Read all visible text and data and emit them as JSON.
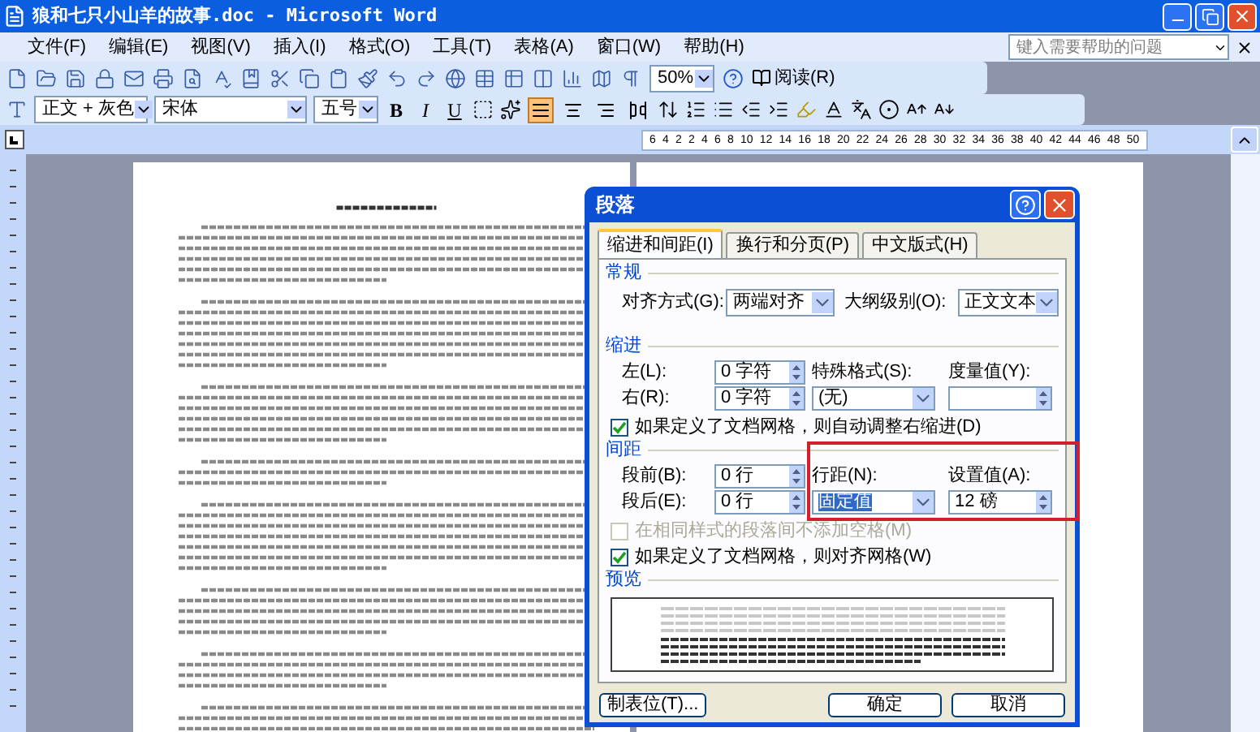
{
  "window": {
    "title": "狼和七只小山羊的故事.doc - Microsoft Word"
  },
  "menu": [
    "文件(F)",
    "编辑(E)",
    "视图(V)",
    "插入(I)",
    "格式(O)",
    "工具(T)",
    "表格(A)",
    "窗口(W)",
    "帮助(H)"
  ],
  "help_search": {
    "placeholder": "键入需要帮助的问题"
  },
  "standard_toolbar": {
    "zoom": "50%",
    "read_button": "阅读(R)"
  },
  "format_toolbar": {
    "style": "正文 + 灰色",
    "font": "宋体",
    "size": "五号",
    "text_buttons": [
      "B",
      "I",
      "U"
    ],
    "alignment": [
      {
        "kind": "justify",
        "selected": true
      },
      {
        "kind": "center",
        "selected": false
      },
      {
        "kind": "right",
        "selected": false
      },
      {
        "kind": "distributed",
        "selected": false
      }
    ]
  },
  "ruler": {
    "numbers": [
      "6",
      "4",
      "2",
      "2",
      "4",
      "6",
      "8",
      "10",
      "12",
      "14",
      "16",
      "18",
      "20",
      "22",
      "24",
      "26",
      "28",
      "30",
      "32",
      "34",
      "36",
      "38",
      "40",
      "42",
      "44",
      "46",
      "48",
      "50"
    ]
  },
  "dialog": {
    "title": "段落",
    "tabs": [
      {
        "label": "缩进和间距(I)",
        "selected": true
      },
      {
        "label": "换行和分页(P)",
        "selected": false
      },
      {
        "label": "中文版式(H)",
        "selected": false
      }
    ],
    "general": {
      "heading": "常规",
      "fields": [
        {
          "kind": "dropdown",
          "label": "对齐方式(G):",
          "value": "两端对齐"
        },
        {
          "kind": "dropdown",
          "label": "大纲级别(O):",
          "value": "正文文本"
        }
      ]
    },
    "indent": {
      "heading": "缩进",
      "left": [
        {
          "kind": "spinner",
          "label": "左(L):",
          "value": "0 字符"
        },
        {
          "kind": "spinner",
          "label": "右(R):",
          "value": "0 字符"
        }
      ],
      "right": [
        {
          "kind": "dropdown",
          "label": "特殊格式(S):",
          "value": "(无)"
        },
        {
          "kind": "spinner",
          "label": "度量值(Y):"
        }
      ]
    },
    "indent_checkbox": {
      "label": "如果定义了文档网格，则自动调整右缩进(D)",
      "checked": true,
      "disabled": false
    },
    "spacing": {
      "heading": "间距",
      "left": [
        {
          "kind": "spinner",
          "label": "段前(B):",
          "value": "0 行"
        },
        {
          "kind": "spinner",
          "label": "段后(E):",
          "value": "0 行"
        }
      ],
      "right": [
        {
          "kind": "dropdown",
          "label": "行距(N):",
          "value": "固定值"
        },
        {
          "kind": "spinner",
          "label": "设置值(A):",
          "value": "12 磅"
        }
      ]
    },
    "spacing_checkboxes": [
      {
        "label": "在相同样式的段落间不添加空格(M)",
        "checked": false,
        "disabled": true
      },
      {
        "label": "如果定义了文档网格，则对齐网格(W)",
        "checked": true,
        "disabled": false
      }
    ],
    "preview": {
      "heading": "预览"
    },
    "buttons": [
      {
        "kind": "secondary",
        "label": "制表位(T)..."
      },
      {
        "kind": "primary",
        "label": "确定"
      },
      {
        "kind": "primary",
        "label": "取消"
      }
    ]
  }
}
